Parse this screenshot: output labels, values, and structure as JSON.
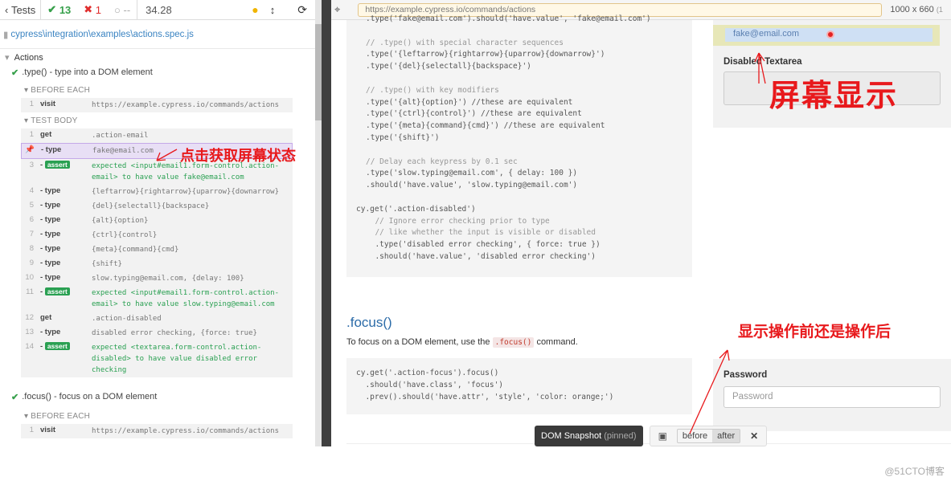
{
  "stats": {
    "tests_label": "Tests",
    "passed": "13",
    "failed": "1",
    "pending": "--",
    "duration": "34.28"
  },
  "spec": {
    "path": "cypress\\integration\\examples\\actions.spec.js"
  },
  "suite": {
    "title": "Actions"
  },
  "test1": {
    "title": ".type() - type into a DOM element",
    "before_each": "BEFORE EACH",
    "test_body": "TEST BODY",
    "hook_cmds": [
      {
        "n": "1",
        "name": "visit",
        "msg": "https://example.cypress.io/commands/actions"
      }
    ],
    "cmds": [
      {
        "n": "1",
        "name": "get",
        "msg": ".action-email"
      },
      {
        "n": "2",
        "name": "- type",
        "msg": "fake@email.com"
      },
      {
        "n": "3",
        "name": "assert",
        "msg": "expected <input#email1.form-control.action-email> to have value fake@email.com"
      },
      {
        "n": "4",
        "name": "- type",
        "msg": "{leftarrow}{rightarrow}{uparrow}{downarrow}"
      },
      {
        "n": "5",
        "name": "- type",
        "msg": "{del}{selectall}{backspace}"
      },
      {
        "n": "6",
        "name": "- type",
        "msg": "{alt}{option}"
      },
      {
        "n": "7",
        "name": "- type",
        "msg": "{ctrl}{control}"
      },
      {
        "n": "8",
        "name": "- type",
        "msg": "{meta}{command}{cmd}"
      },
      {
        "n": "9",
        "name": "- type",
        "msg": "{shift}"
      },
      {
        "n": "10",
        "name": "- type",
        "msg": "slow.typing@email.com, {delay: 100}"
      },
      {
        "n": "11",
        "name": "assert",
        "msg": "expected <input#email1.form-control.action-email> to have value slow.typing@email.com"
      },
      {
        "n": "12",
        "name": "get",
        "msg": ".action-disabled"
      },
      {
        "n": "13",
        "name": "- type",
        "msg": "disabled error checking, {force: true}"
      },
      {
        "n": "14",
        "name": "assert",
        "msg": "expected <textarea.form-control.action-disabled> to have value disabled error checking"
      }
    ]
  },
  "test2": {
    "title": ".focus() - focus on a DOM element",
    "before_each": "BEFORE EACH",
    "hook_cmds": [
      {
        "n": "1",
        "name": "visit",
        "msg": "https://example.cypress.io/commands/actions"
      }
    ]
  },
  "aut": {
    "url": "https://example.cypress.io/commands/actions",
    "viewport": "1000 x 660",
    "viewport_extra": "(1",
    "code1": [
      ".type('fake@email.com').should('have.value', 'fake@email.com')",
      "",
      "// .type() with special character sequences",
      ".type('{leftarrow}{rightarrow}{uparrow}{downarrow}')",
      ".type('{del}{selectall}{backspace}')",
      "",
      "// .type() with key modifiers",
      ".type('{alt}{option}') //these are equivalent",
      ".type('{ctrl}{control}') //these are equivalent",
      ".type('{meta}{command}{cmd}') //these are equivalent",
      ".type('{shift}')",
      "",
      "// Delay each keypress by 0.1 sec",
      ".type('slow.typing@email.com', { delay: 100 })",
      ".should('have.value', 'slow.typing@email.com')",
      "",
      "cy.get('.action-disabled')",
      "  // Ignore error checking prior to type",
      "  // like whether the input is visible or disabled",
      "  .type('disabled error checking', { force: true })",
      "  .should('have.value', 'disabled error checking')"
    ],
    "email_value": "fake@email.com",
    "disabled_label": "Disabled Textarea",
    "focus_title": ".focus()",
    "focus_desc_pre": "To focus on a DOM element, use the",
    "focus_desc_code": ".focus()",
    "focus_desc_post": "command.",
    "code2": [
      "cy.get('.action-focus').focus()",
      "  .should('have.class', 'focus')",
      "  .prev().should('have.attr', 'style', 'color: orange;')"
    ],
    "password_label": "Password",
    "password_placeholder": "Password"
  },
  "annotations": {
    "click_state": "点击获取屏幕状态",
    "screen_display": "屏幕显示",
    "before_after": "显示操作前还是操作后"
  },
  "snapshot": {
    "label": "DOM Snapshot",
    "pinned": "(pinned)",
    "before": "before",
    "after": "after",
    "close": "✕"
  },
  "watermark": "@51CTO博客"
}
